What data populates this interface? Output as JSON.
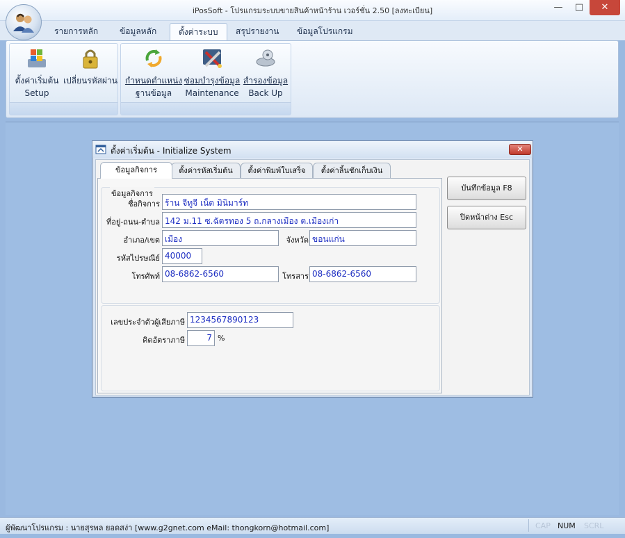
{
  "window": {
    "title": "iPosSoft - โปรแกรมระบบขายสินค้าหน้าร้าน เวอร์ชั่น 2.50 [ลงทะเบียน]",
    "minimize_glyph": "—",
    "maximize_glyph": "□",
    "close_glyph": "✕"
  },
  "ribbon": {
    "tabs": [
      {
        "label": "รายการหลัก"
      },
      {
        "label": "ข้อมูลหลัก"
      },
      {
        "label": "ตั้งค่าระบบ"
      },
      {
        "label": "สรุปรายงาน"
      },
      {
        "label": "ข้อมูลโปรแกรม"
      }
    ],
    "buttons": [
      {
        "line1": "ตั้งค่าเริ่มต้น",
        "line2": "Setup",
        "icon": "windows-setup-icon"
      },
      {
        "line1": "เปลี่ยนรหัสผ่าน",
        "line2": "",
        "icon": "padlock-icon"
      },
      {
        "line1": "กำหนดตำแหน่ง",
        "line2": "ฐานข้อมูล",
        "icon": "database-sync-icon"
      },
      {
        "line1": "ซ่อมบำรุงข้อมูล",
        "line2": "Maintenance",
        "icon": "tools-icon"
      },
      {
        "line1": "สำรองข้อมูล",
        "line2": "Back Up",
        "icon": "backup-icon"
      }
    ]
  },
  "dialog": {
    "title": "ตั้งค่าเริ่มต้น - Initialize System",
    "close_glyph": "✕",
    "tabs": [
      {
        "label": "ข้อมูลกิจการ"
      },
      {
        "label": "ตั้งค่ารหัสเริ่มต้น"
      },
      {
        "label": "ตั้งค่าพิมพ์ใบเสร็จ"
      },
      {
        "label": "ตั้งค่าลิ้นชักเก็บเงิน"
      }
    ],
    "business_group": {
      "title": "ข้อมูลกิจการ",
      "name_label": "ชื่อกิจการ",
      "name_value": "ร้าน จีทูจี เน็ต มินิมาร์ท",
      "address_label": "ที่อยู่-ถนน-ตำบล",
      "address_value": "142 ม.11 ซ.ฉัตรทอง 5 ถ.กลางเมือง ต.เมืองเก่า",
      "district_label": "อำเภอ/เขต",
      "district_value": "เมือง",
      "province_label": "จังหวัด",
      "province_value": "ขอนแก่น",
      "postal_label": "รหัสไปรษณีย์",
      "postal_value": "40000",
      "phone_label": "โทรศัพท์",
      "phone_value": "08-6862-6560",
      "fax_label": "โทรสาร",
      "fax_value": "08-6862-6560"
    },
    "tax_group": {
      "taxid_label": "เลขประจำตัวผู้เสียภาษี",
      "taxid_value": "1234567890123",
      "vat_label": "คิดอัตราภาษี",
      "vat_value": "7",
      "vat_unit": "%"
    },
    "save_button": "บันทึกข้อมูล F8",
    "close_button": "ปิดหน้าต่าง Esc"
  },
  "statusbar": {
    "text": "ผู้พัฒนาโปรแกรม : นายสุรพล ยอดสง่า [www.g2gnet.com  eMail: thongkorn@hotmail.com]",
    "cap": "CAP",
    "num": "NUM",
    "scrl": "SCRL"
  },
  "colors": {
    "accent": "#1c2dc2",
    "mdi_background": "#9ebde3",
    "close_red": "#c7473a"
  }
}
